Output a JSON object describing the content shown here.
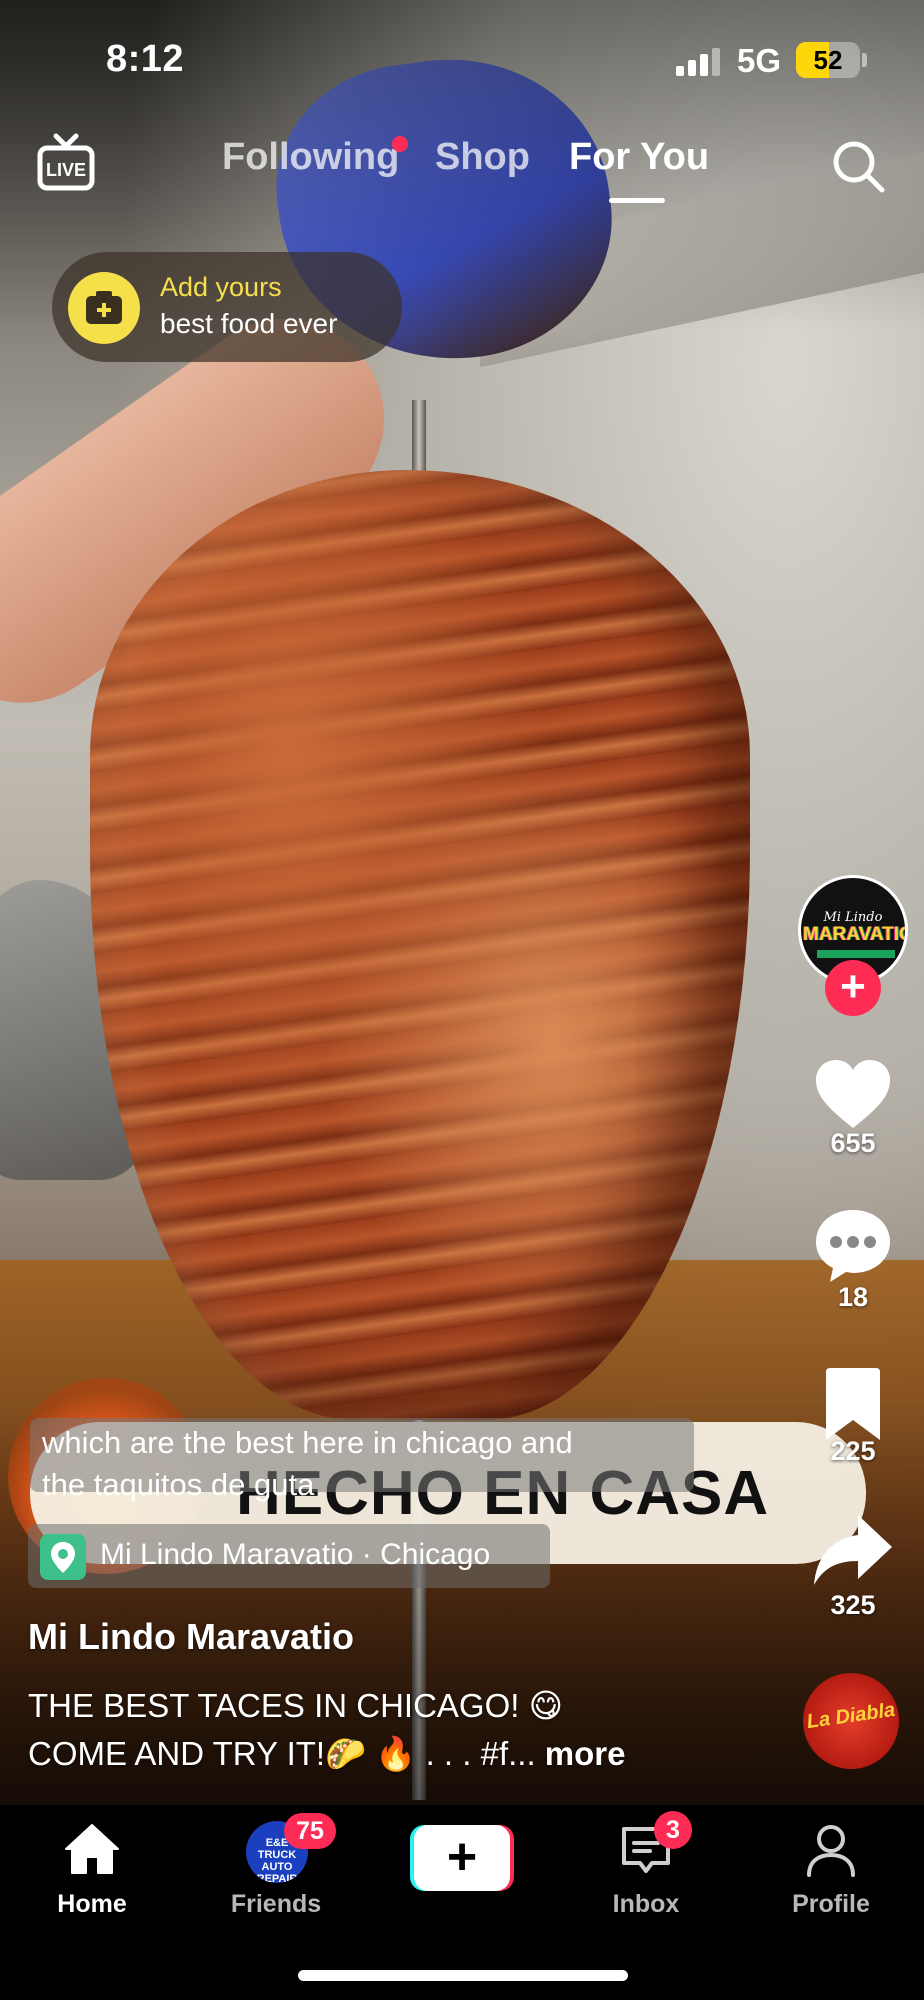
{
  "status_bar": {
    "time": "8:12",
    "network": "5G",
    "battery": "52",
    "battery_level_percent": 52
  },
  "top_nav": {
    "tabs": [
      {
        "label": "Following",
        "has_dot": true
      },
      {
        "label": "Shop"
      },
      {
        "label": "For You",
        "active": true
      }
    ],
    "icons": [
      "live-tv-icon",
      "search-icon"
    ]
  },
  "add_yours": {
    "title": "Add yours",
    "subtitle": "best food ever"
  },
  "video": {
    "overlay_text": "HECHO EN CASA",
    "sticker_caption_lines": [
      "which are the best here in chicago and",
      "the taquitos de guta"
    ]
  },
  "location": {
    "text": "Mi Lindo Maravatio · Chicago"
  },
  "post": {
    "author": "Mi Lindo Maravatio",
    "desc_line1": "THE BEST TACES IN CHICAGO! 😋",
    "desc_line2": "COME AND TRY IT!🌮 🔥 . . . #f...",
    "more_label": "more"
  },
  "actions": {
    "avatar_script": "Mi Lindo",
    "avatar_word": "MARAVATIO",
    "likes": "655",
    "comments": "18",
    "saves": "225",
    "shares": "325",
    "sound_disc_label": "La Diabla"
  },
  "tabbar": {
    "home": "Home",
    "friends": "Friends",
    "friends_badge": "75",
    "friends_avatar_text": "E&E TRUCK AUTO REPAIR",
    "create_symbol": "+",
    "inbox": "Inbox",
    "inbox_badge": "3",
    "profile": "Profile"
  },
  "colors": {
    "accent_red": "#fe2c55",
    "accent_cyan": "#25f4ee",
    "add_yours_yellow": "#f6e04a",
    "battery_yellow": "#ffd60a"
  }
}
